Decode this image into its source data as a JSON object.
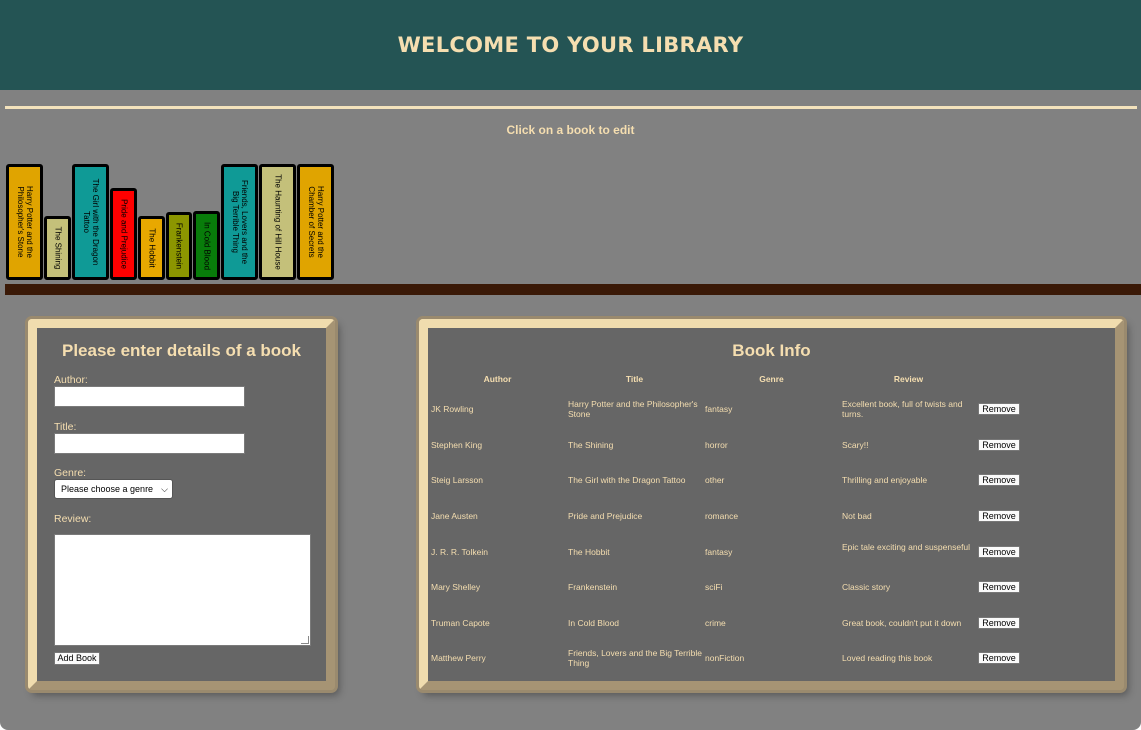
{
  "header": {
    "title": "WELCOME TO YOUR LIBRARY"
  },
  "shelf": {
    "hint": "Click on a book to edit",
    "books": [
      {
        "title": "Harry Potter and the Philosopher's Stone",
        "color": "#e0a400"
      },
      {
        "title": "The Shining",
        "color": "#c4c07a"
      },
      {
        "title": "The Girl with the Dragon Tattoo",
        "color": "#0f9a96"
      },
      {
        "title": "Pride and Prejudice",
        "color": "#ff0000"
      },
      {
        "title": "The Hobbit",
        "color": "#e8a800"
      },
      {
        "title": "Frankenstein",
        "color": "#8c9600"
      },
      {
        "title": "In Cold Blood",
        "color": "#087c0a"
      },
      {
        "title": "Friends, Lovers and the Big Terrible Thing",
        "color": "#0f9a96"
      },
      {
        "title": "The Haunting of Hill House",
        "color": "#c4c07a"
      },
      {
        "title": "Harry Potter and the Chamber of Secrets",
        "color": "#e0a400"
      }
    ]
  },
  "form": {
    "title": "Please enter details of a book",
    "author_label": "Author:",
    "title_label": "Title:",
    "genre_label": "Genre:",
    "genre_selected": "Please choose a genre",
    "review_label": "Review:",
    "add_button": "Add Book"
  },
  "info": {
    "title": "Book Info",
    "columns": [
      "Author",
      "Title",
      "Genre",
      "Review"
    ],
    "remove_label": "Remove",
    "rows": [
      {
        "author": "JK Rowling",
        "title": "Harry Potter and the Philosopher's Stone",
        "genre": "fantasy",
        "review": "Excellent book, full of twists and turns."
      },
      {
        "author": "Stephen King",
        "title": "The Shining",
        "genre": "horror",
        "review": "Scary!!"
      },
      {
        "author": "Steig Larsson",
        "title": "The Girl with the Dragon Tattoo",
        "genre": "other",
        "review": "Thrilling and enjoyable"
      },
      {
        "author": "Jane Austen",
        "title": "Pride and Prejudice",
        "genre": "romance",
        "review": "Not bad"
      },
      {
        "author": "J. R. R. Tolkein",
        "title": "The Hobbit",
        "genre": "fantasy",
        "review": "Epic tale exciting and suspenseful"
      },
      {
        "author": "Mary Shelley",
        "title": "Frankenstein",
        "genre": "sciFi",
        "review": "Classic story"
      },
      {
        "author": "Truman Capote",
        "title": "In Cold Blood",
        "genre": "crime",
        "review": "Great book, couldn't put it down"
      },
      {
        "author": "Matthew Perry",
        "title": "Friends, Lovers and the Big Terrible Thing",
        "genre": "nonFiction",
        "review": "Loved reading this book"
      }
    ]
  }
}
